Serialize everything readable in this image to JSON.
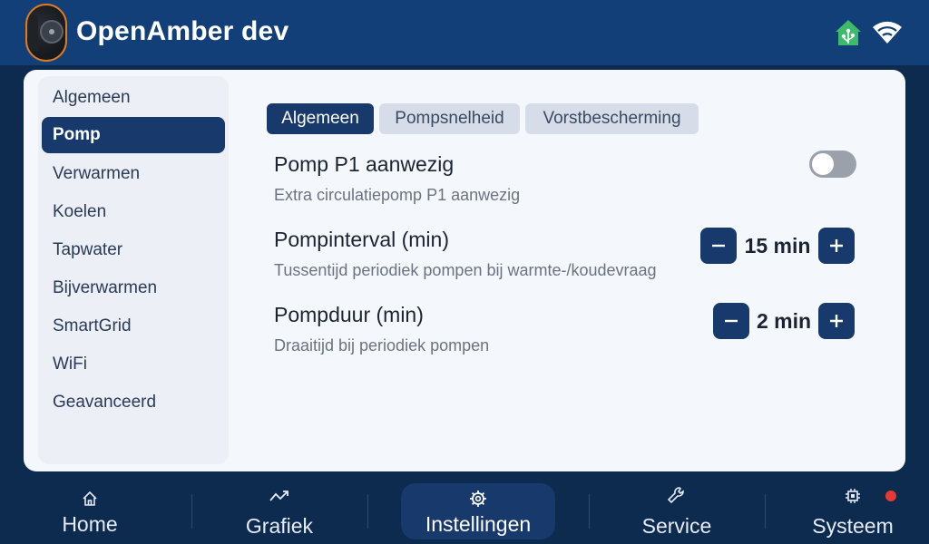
{
  "header": {
    "title": "OpenAmber dev",
    "icons": [
      "home-assistant-icon",
      "wifi-icon"
    ]
  },
  "sidebar": {
    "items": [
      {
        "label": "Algemeen"
      },
      {
        "label": "Pomp",
        "active": true
      },
      {
        "label": "Verwarmen"
      },
      {
        "label": "Koelen"
      },
      {
        "label": "Tapwater"
      },
      {
        "label": "Bijverwarmen"
      },
      {
        "label": "SmartGrid"
      },
      {
        "label": "WiFi"
      },
      {
        "label": "Geavanceerd"
      }
    ]
  },
  "tabs": [
    {
      "label": "Algemeen",
      "active": true
    },
    {
      "label": "Pompsnelheid"
    },
    {
      "label": "Vorstbescherming"
    }
  ],
  "settings": [
    {
      "title": "Pomp P1 aanwezig",
      "description": "Extra circulatiepomp P1 aanwezig",
      "control": "toggle",
      "enabled": false
    },
    {
      "title": "Pompinterval (min)",
      "description": "Tussentijd periodiek pompen bij warmte-/koudevraag",
      "control": "stepper",
      "value": "15 min"
    },
    {
      "title": "Pompduur (min)",
      "description": "Draaitijd bij periodiek pompen",
      "control": "stepper",
      "value": "2 min"
    }
  ],
  "nav": {
    "items": [
      {
        "label": "Home",
        "icon": "home-icon"
      },
      {
        "label": "Grafiek",
        "icon": "chart-icon"
      },
      {
        "label": "Instellingen",
        "icon": "gear-icon",
        "active": true
      },
      {
        "label": "Service",
        "icon": "wrench-icon"
      },
      {
        "label": "Systeem",
        "icon": "chip-icon",
        "alert": true
      }
    ]
  },
  "colors": {
    "header_bg": "#123f78",
    "accent": "#17396b",
    "alert": "#e53935",
    "home_assistant": "#3dbb6a"
  }
}
